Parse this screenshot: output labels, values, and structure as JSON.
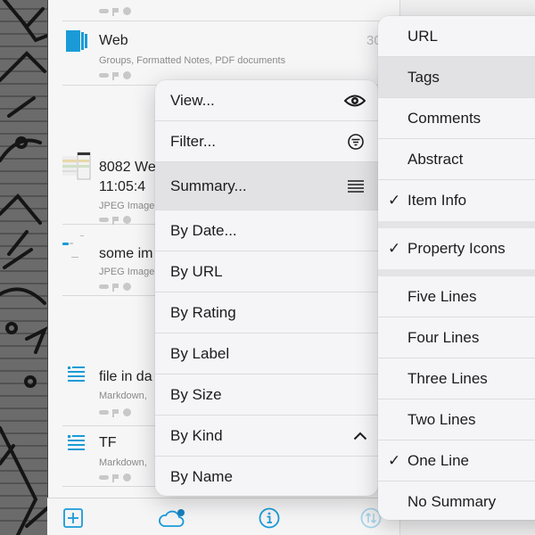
{
  "document_list": {
    "items": [
      {
        "title": "",
        "subtitle": "",
        "icon": "partial-item"
      },
      {
        "title": "Web",
        "subtitle": "Groups, Formatted Notes, PDF documents",
        "icon": "group-icon",
        "count": "30"
      },
      {
        "title": "8082 We",
        "title_line2": "11:05:4",
        "subtitle": "JPEG Image",
        "icon": "image-thumbnail"
      },
      {
        "title": "some im",
        "subtitle": "JPEG Image",
        "icon": "image-thumbnail"
      },
      {
        "title": "file in da",
        "subtitle": "Markdown, ",
        "icon": "markdown-icon"
      },
      {
        "title": "TF",
        "subtitle": "Markdown, ",
        "icon": "markdown-icon"
      }
    ]
  },
  "toolbar": {
    "buttons": [
      {
        "name": "add",
        "icon": "plus-square-icon"
      },
      {
        "name": "sync",
        "icon": "cloud-icon"
      },
      {
        "name": "info",
        "icon": "info-icon"
      },
      {
        "name": "sort",
        "icon": "sort-arrows-icon"
      }
    ]
  },
  "main_menu": {
    "items": [
      {
        "label": "View...",
        "icon": "eye-icon"
      },
      {
        "label": "Filter...",
        "icon": "filter-icon"
      },
      {
        "label": "Summary...",
        "icon": "lines-icon",
        "highlighted": true
      },
      {
        "label": "By Date..."
      },
      {
        "label": "By URL"
      },
      {
        "label": "By Rating"
      },
      {
        "label": "By Label"
      },
      {
        "label": "By Size"
      },
      {
        "label": "By Kind",
        "icon": "chevron-up-icon"
      },
      {
        "label": "By Name"
      }
    ]
  },
  "summary_menu": {
    "check_glyph": "✓",
    "group1": [
      {
        "label": "URL",
        "checked": false
      },
      {
        "label": "Tags",
        "checked": false,
        "highlighted": true
      },
      {
        "label": "Comments",
        "checked": false
      },
      {
        "label": "Abstract",
        "checked": false
      },
      {
        "label": "Item Info",
        "checked": true
      }
    ],
    "group2": [
      {
        "label": "Property Icons",
        "checked": true
      }
    ],
    "group3": [
      {
        "label": "Five Lines",
        "checked": false
      },
      {
        "label": "Four Lines",
        "checked": false
      },
      {
        "label": "Three Lines",
        "checked": false
      },
      {
        "label": "Two Lines",
        "checked": false
      },
      {
        "label": "One Line",
        "checked": true
      },
      {
        "label": "No Summary",
        "checked": false
      }
    ]
  },
  "colors": {
    "accent": "#1a9bd7",
    "menu_bg": "#f5f5f7",
    "highlight": "#e2e2e4"
  }
}
